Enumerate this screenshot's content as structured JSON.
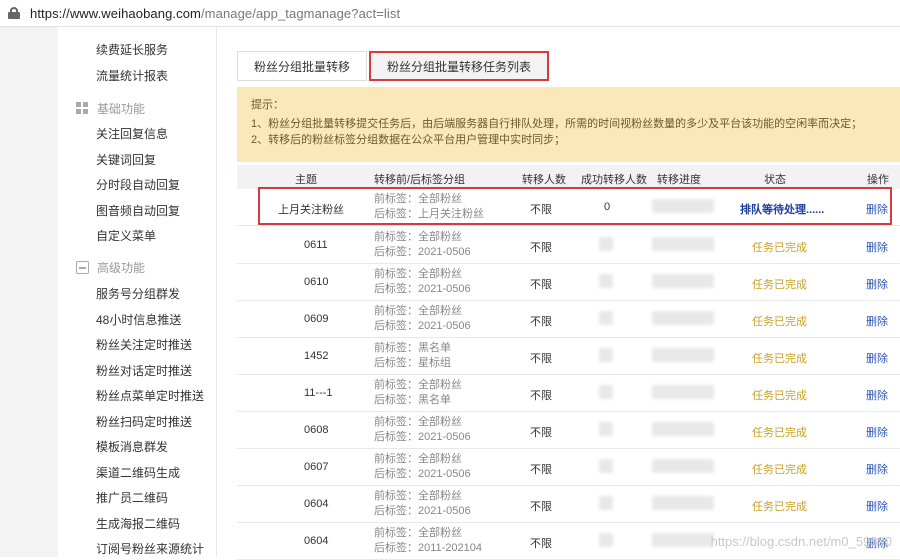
{
  "browser": {
    "url_host": "https://www.weihaobang.com",
    "url_path": "/manage/app_tagmanage?act=list"
  },
  "sidebar": {
    "top_items": [
      "续费延长服务",
      "流量统计报表"
    ],
    "sections": [
      {
        "title": "基础功能",
        "icon": "grid-icon",
        "items": [
          "关注回复信息",
          "关键词回复",
          "分时段自动回复",
          "图音频自动回复",
          "自定义菜单"
        ]
      },
      {
        "title": "高级功能",
        "icon": "message-icon",
        "items": [
          "服务号分组群发",
          "48小时信息推送",
          "粉丝关注定时推送",
          "粉丝对话定时推送",
          "粉丝点菜单定时推送",
          "粉丝扫码定时推送",
          "模板消息群发",
          "渠道二维码生成",
          "推广员二维码",
          "生成海报二维码",
          "订阅号粉丝来源统计"
        ]
      }
    ]
  },
  "tabs": [
    {
      "label": "粉丝分组批量转移"
    },
    {
      "label": "粉丝分组批量转移任务列表"
    }
  ],
  "tip": {
    "title": "提示：",
    "lines": [
      "1、粉丝分组批量转移提交任务后，由后端服务器自行排队处理，所需的时间视粉丝数量的多少及平台该功能的空闲率而决定；",
      "2、转移后的粉丝标签分组数据在公众平台用户管理中实时同步；"
    ]
  },
  "table": {
    "headers": [
      "主题",
      "转移前/后标签分组",
      "转移人数",
      "成功转移人数",
      "转移进度",
      "状态",
      "操作"
    ],
    "rows": [
      {
        "subject": "上月关注粉丝",
        "before": "前标签：全部粉丝",
        "after": "后标签：上月关注粉丝",
        "count": "不限",
        "success": "0",
        "status": "排队等待处理......",
        "status_type": "queue",
        "op": "删除"
      },
      {
        "subject": "0611",
        "before": "前标签：全部粉丝",
        "after": "后标签：2021-0506",
        "count": "不限",
        "success": "",
        "status": "任务已完成",
        "status_type": "done",
        "op": "删除"
      },
      {
        "subject": "0610",
        "before": "前标签：全部粉丝",
        "after": "后标签：2021-0506",
        "count": "不限",
        "success": "",
        "status": "任务已完成",
        "status_type": "done",
        "op": "删除"
      },
      {
        "subject": "0609",
        "before": "前标签：全部粉丝",
        "after": "后标签：2021-0506",
        "count": "不限",
        "success": "",
        "status": "任务已完成",
        "status_type": "done",
        "op": "删除"
      },
      {
        "subject": "1452",
        "before": "前标签：黑名单",
        "after": "后标签：星标组",
        "count": "不限",
        "success": "",
        "status": "任务已完成",
        "status_type": "done",
        "op": "删除"
      },
      {
        "subject": "11---1",
        "before": "前标签：全部粉丝",
        "after": "后标签：黑名单",
        "count": "不限",
        "success": "",
        "status": "任务已完成",
        "status_type": "done",
        "op": "删除"
      },
      {
        "subject": "0608",
        "before": "前标签：全部粉丝",
        "after": "后标签：2021-0506",
        "count": "不限",
        "success": "",
        "status": "任务已完成",
        "status_type": "done",
        "op": "删除"
      },
      {
        "subject": "0607",
        "before": "前标签：全部粉丝",
        "after": "后标签：2021-0506",
        "count": "不限",
        "success": "",
        "status": "任务已完成",
        "status_type": "done",
        "op": "删除"
      },
      {
        "subject": "0604",
        "before": "前标签：全部粉丝",
        "after": "后标签：2021-0506",
        "count": "不限",
        "success": "",
        "status": "任务已完成",
        "status_type": "done",
        "op": "删除"
      },
      {
        "subject": "0604",
        "before": "前标签：全部粉丝",
        "after": "后标签：2011-202104",
        "count": "不限",
        "success": "",
        "status": "",
        "status_type": "done",
        "op": "删除"
      }
    ]
  },
  "watermark": "https://blog.csdn.net/m0_59890"
}
